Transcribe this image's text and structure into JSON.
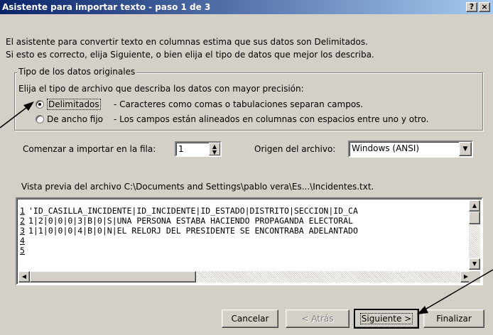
{
  "window": {
    "title": "Asistente para importar texto - paso 1 de 3",
    "help_label": "?",
    "close_label": "×"
  },
  "intro": {
    "line1": "El asistente para convertir texto en columnas estima que sus datos son Delimitados.",
    "line2": "Si esto es correcto, elija Siguiente, o bien elija el tipo de datos que mejor los describa."
  },
  "data_type": {
    "legend": "Tipo de los datos originales",
    "instruction": "Elija el tipo de archivo que describa los datos con mayor precisión:",
    "options": [
      {
        "label": "Delimitados",
        "description": "- Caracteres como comas o tabulaciones separan campos.",
        "selected": true
      },
      {
        "label": "De ancho fijo",
        "description": "- Los campos están alineados en columnas con espacios entre uno y otro.",
        "selected": false
      }
    ]
  },
  "import_settings": {
    "start_row_label": "Comenzar a importar en la fila:",
    "start_row_value": "1",
    "origin_label": "Origen del archivo:",
    "origin_value": "Windows (ANSI)"
  },
  "preview": {
    "label": "Vista previa del archivo C:\\Documents and Settings\\pablo vera\\Es...\\Incidentes.txt.",
    "rows": [
      {
        "num": "1",
        "text": "'ID_CASILLA_INCIDENTE|ID_INCIDENTE|ID_ESTADO|DISTRITO|SECCION|ID_CA"
      },
      {
        "num": "2",
        "text": "1|2|0|0|0|3|B|0|S|UNA PERSONA ESTABA HACIENDO PROPAGANDA ELECTORAL"
      },
      {
        "num": "3",
        "text": "1|1|0|0|0|4|B|0|N|EL RELORJ DEL PRESIDENTE SE ENCONTRABA ADELANTADO"
      },
      {
        "num": "4",
        "text": ""
      },
      {
        "num": "5",
        "text": ""
      }
    ]
  },
  "buttons": {
    "cancel": "Cancelar",
    "back": "< Atrás",
    "next": "Siguiente >",
    "finish": "Finalizar"
  }
}
